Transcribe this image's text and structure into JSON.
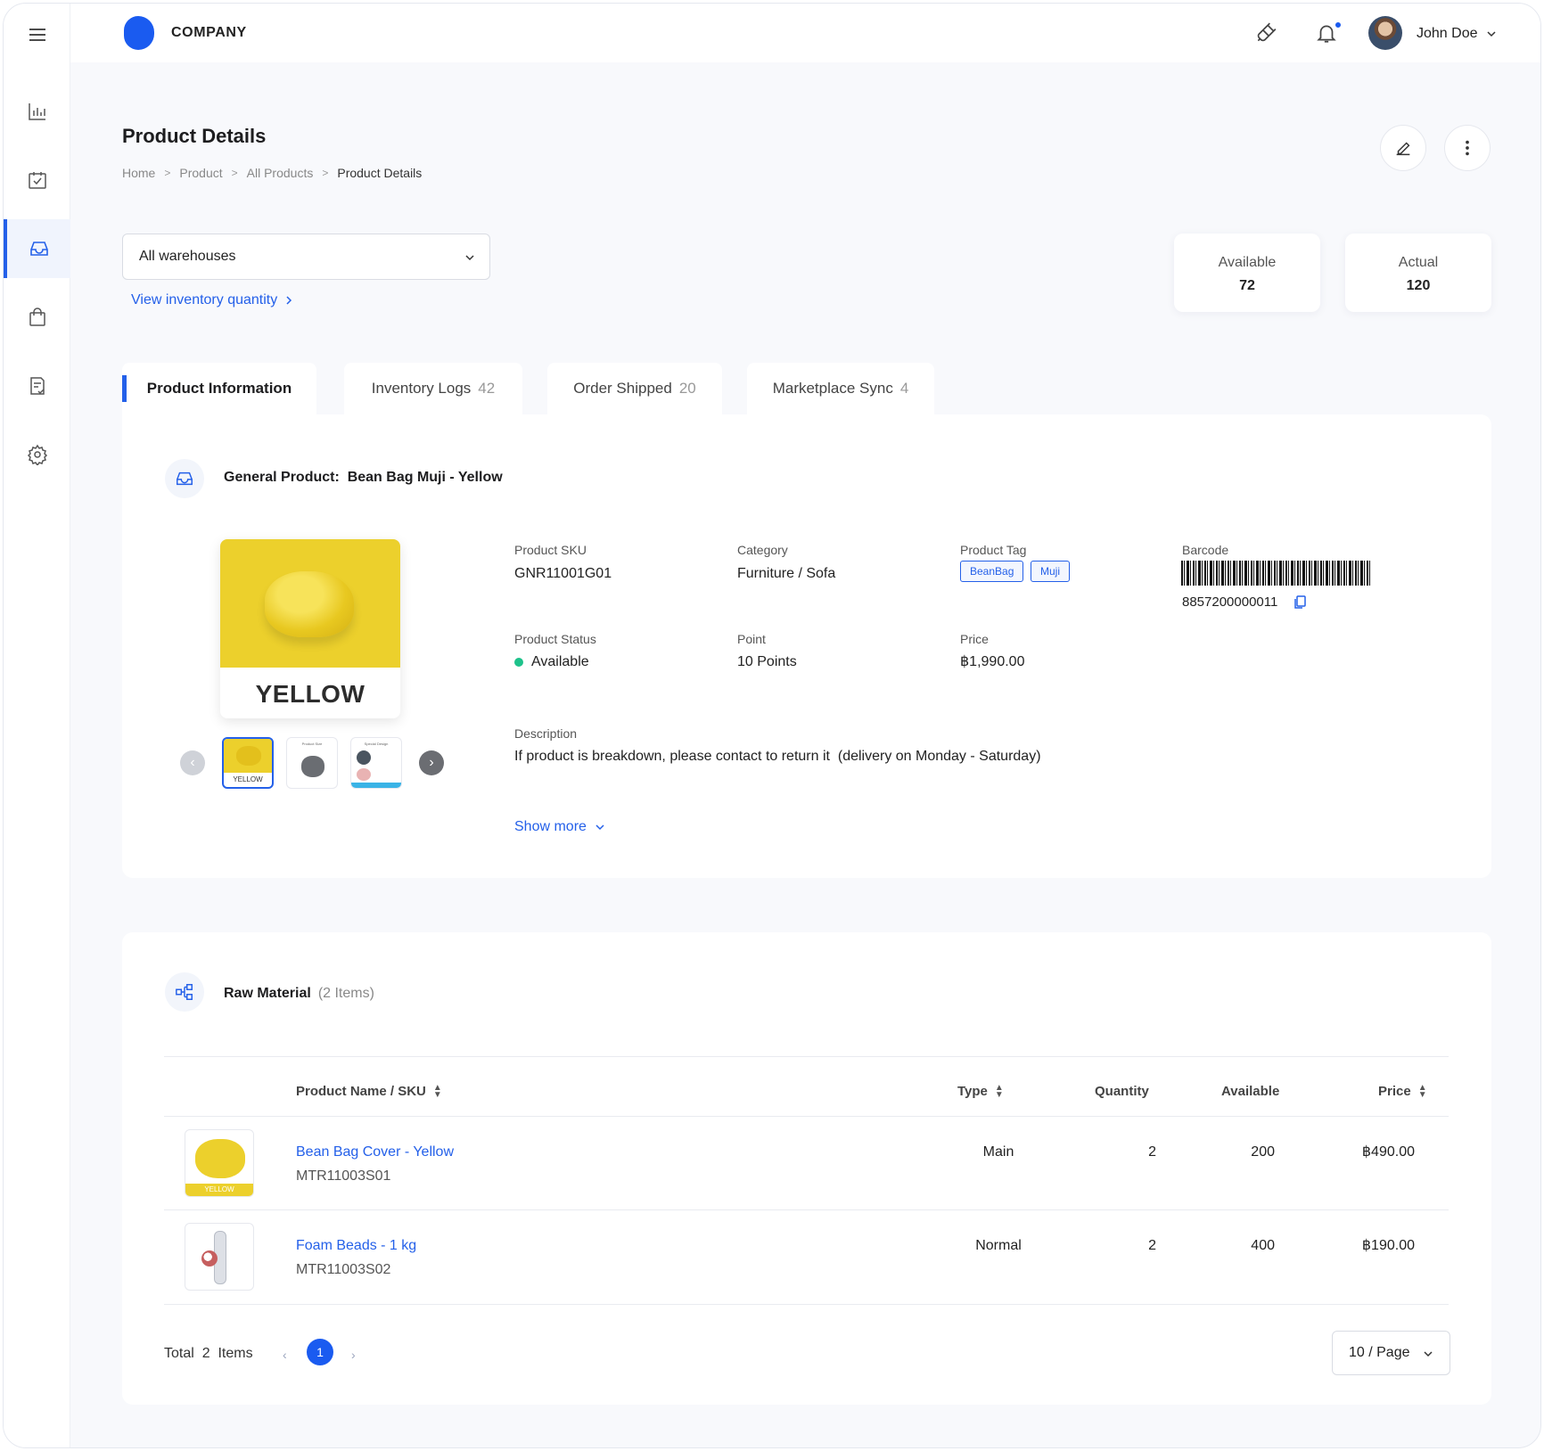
{
  "app": {
    "company": "COMPANY"
  },
  "user": {
    "name": "John Doe"
  },
  "header": {
    "title": "Product Details",
    "breadcrumb": [
      "Home",
      "Product",
      "All Products",
      "Product Details"
    ]
  },
  "warehouse": {
    "selected": "All warehouses",
    "link": "View inventory quantity"
  },
  "stats": [
    {
      "label": "Available",
      "value": "72"
    },
    {
      "label": "Actual",
      "value": "120"
    }
  ],
  "tabs": [
    {
      "label": "Product Information",
      "count": ""
    },
    {
      "label": "Inventory Logs",
      "count": "42"
    },
    {
      "label": "Order Shipped",
      "count": "20"
    },
    {
      "label": "Marketplace Sync",
      "count": "4"
    }
  ],
  "product": {
    "title_prefix": "General Product:",
    "title": "Bean Bag Muji - Yellow",
    "image_word": "YELLOW",
    "thumb_word": "YELLOW",
    "thumb2_caption": "Product Size",
    "thumb3_caption": "Special Design",
    "sku_label": "Product SKU",
    "sku": "GNR11001G01",
    "category_label": "Category",
    "category": "Furniture / Sofa",
    "tag_label": "Product Tag",
    "tags": [
      "BeanBag",
      "Muji"
    ],
    "barcode_label": "Barcode",
    "barcode": "8857200000011",
    "status_label": "Product Status",
    "status": "Available",
    "point_label": "Point",
    "point": "10 Points",
    "price_label": "Price",
    "price": "฿1,990.00",
    "description_label": "Description",
    "description": "If product is breakdown, please contact to return it  (delivery on Monday - Saturday)",
    "show_more": "Show more"
  },
  "raw_material": {
    "title": "Raw Material",
    "count": "(2 Items)",
    "columns": {
      "name": "Product Name / SKU",
      "type": "Type",
      "quantity": "Quantity",
      "available": "Available",
      "price": "Price"
    },
    "rows": [
      {
        "name": "Bean Bag Cover - Yellow",
        "sku": "MTR11003S01",
        "type": "Main",
        "quantity": "2",
        "available": "200",
        "price": "฿490.00",
        "image_word": "YELLOW"
      },
      {
        "name": "Foam Beads - 1 kg",
        "sku": "MTR11003S02",
        "type": "Normal",
        "quantity": "2",
        "available": "400",
        "price": "฿190.00",
        "image_word": ""
      }
    ],
    "pager": {
      "total_label": "Total",
      "total": "2",
      "items_label": "Items",
      "current": "1",
      "page_size": "10 / Page"
    }
  },
  "colors": {
    "accent": "#2460e9",
    "logo": "#1a5bf0",
    "status_available": "#1ec28b",
    "product_yellow": "#ecd02c"
  }
}
